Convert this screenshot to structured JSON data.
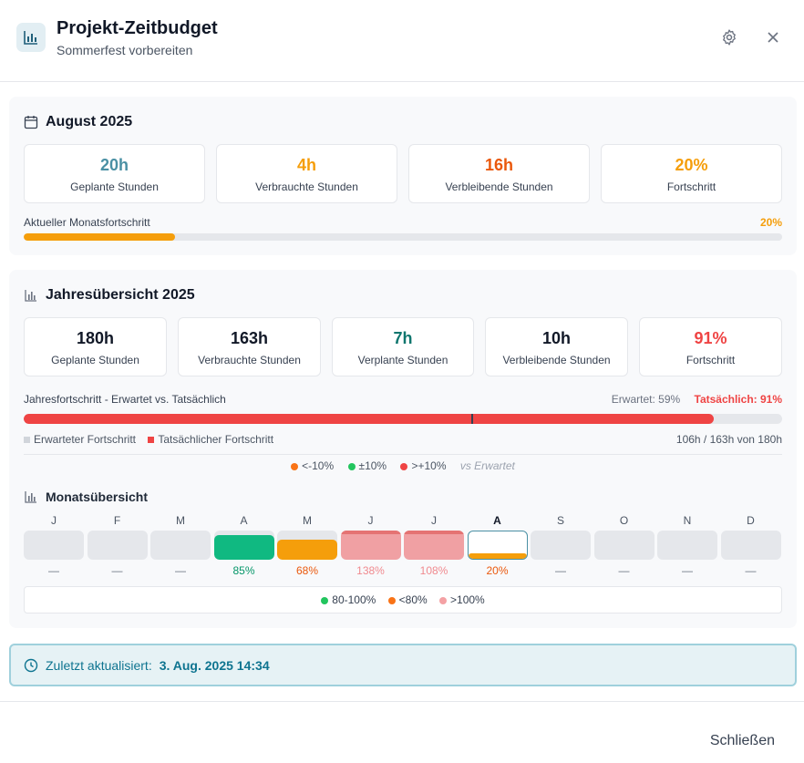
{
  "header": {
    "title": "Projekt-Zeitbudget",
    "subtitle": "Sommerfest vorbereiten",
    "icon": "bar-chart-icon"
  },
  "month": {
    "title": "August 2025",
    "stats": [
      {
        "value": "20h",
        "label": "Geplante Stunden",
        "color": "#4a90a4"
      },
      {
        "value": "4h",
        "label": "Verbrauchte Stunden",
        "color": "#f59e0b"
      },
      {
        "value": "16h",
        "label": "Verbleibende Stunden",
        "color": "#ea580c"
      },
      {
        "value": "20%",
        "label": "Fortschritt",
        "color": "#f59e0b"
      }
    ],
    "progress_label": "Aktueller Monatsfortschritt",
    "progress_value": "20%",
    "progress_fraction": 0.2
  },
  "year": {
    "title": "Jahresübersicht 2025",
    "stats": [
      {
        "value": "180h",
        "label": "Geplante Stunden",
        "color": "#111827"
      },
      {
        "value": "163h",
        "label": "Verbrauchte Stunden",
        "color": "#111827"
      },
      {
        "value": "7h",
        "label": "Verplante Stunden",
        "color": "#0f766e"
      },
      {
        "value": "10h",
        "label": "Verbleibende Stunden",
        "color": "#111827"
      },
      {
        "value": "91%",
        "label": "Fortschritt",
        "color": "#ef4444"
      }
    ],
    "compare_label": "Jahresfortschritt - Erwartet vs. Tatsächlich",
    "expected_text": "Erwartet: 59%",
    "actual_text": "Tatsächlich: 91%",
    "expected_fraction": 0.59,
    "actual_fraction": 0.91,
    "legend_expected": "Erwarteter Fortschritt",
    "legend_actual": "Tatsächlicher Fortschritt",
    "hours_summary": "106h / 163h von 180h",
    "deviation_legend": [
      {
        "label": "<-10%",
        "color": "#f97316"
      },
      {
        "label": "±10%",
        "color": "#22c55e"
      },
      {
        "label": ">+10%",
        "color": "#ef4444"
      }
    ],
    "deviation_note": "vs Erwartet"
  },
  "months_overview": {
    "title": "Monatsübersicht",
    "months": [
      {
        "letter": "J",
        "pct": "—",
        "fill": 0,
        "color": "#e5e7eb",
        "text_color": "#6b7280"
      },
      {
        "letter": "F",
        "pct": "—",
        "fill": 0,
        "color": "#e5e7eb",
        "text_color": "#6b7280"
      },
      {
        "letter": "M",
        "pct": "—",
        "fill": 0,
        "color": "#e5e7eb",
        "text_color": "#6b7280"
      },
      {
        "letter": "A",
        "pct": "85%",
        "fill": 0.85,
        "color": "#10b981",
        "text_color": "#059669"
      },
      {
        "letter": "M",
        "pct": "68%",
        "fill": 0.68,
        "color": "#f59e0b",
        "text_color": "#ea580c"
      },
      {
        "letter": "J",
        "pct": "138%",
        "fill": 1.38,
        "color": "#f0a0a3",
        "text_color": "#f08a8f"
      },
      {
        "letter": "J",
        "pct": "108%",
        "fill": 1.08,
        "color": "#f0a0a3",
        "text_color": "#f08a8f"
      },
      {
        "letter": "A",
        "pct": "20%",
        "fill": 0.2,
        "color": "#f59e0b",
        "text_color": "#ea580c",
        "current": true
      },
      {
        "letter": "S",
        "pct": "—",
        "fill": 0,
        "color": "#e5e7eb",
        "text_color": "#6b7280"
      },
      {
        "letter": "O",
        "pct": "—",
        "fill": 0,
        "color": "#e5e7eb",
        "text_color": "#6b7280"
      },
      {
        "letter": "N",
        "pct": "—",
        "fill": 0,
        "color": "#e5e7eb",
        "text_color": "#6b7280"
      },
      {
        "letter": "D",
        "pct": "—",
        "fill": 0,
        "color": "#e5e7eb",
        "text_color": "#6b7280"
      }
    ],
    "legend": [
      {
        "label": "80-100%",
        "color": "#22c55e"
      },
      {
        "label": "<80%",
        "color": "#f97316"
      },
      {
        "label": ">100%",
        "color": "#f4a1a4"
      }
    ]
  },
  "footer": {
    "updated_label": "Zuletzt aktualisiert:",
    "updated_value": "3. Aug. 2025 14:34",
    "close_label": "Schließen"
  }
}
